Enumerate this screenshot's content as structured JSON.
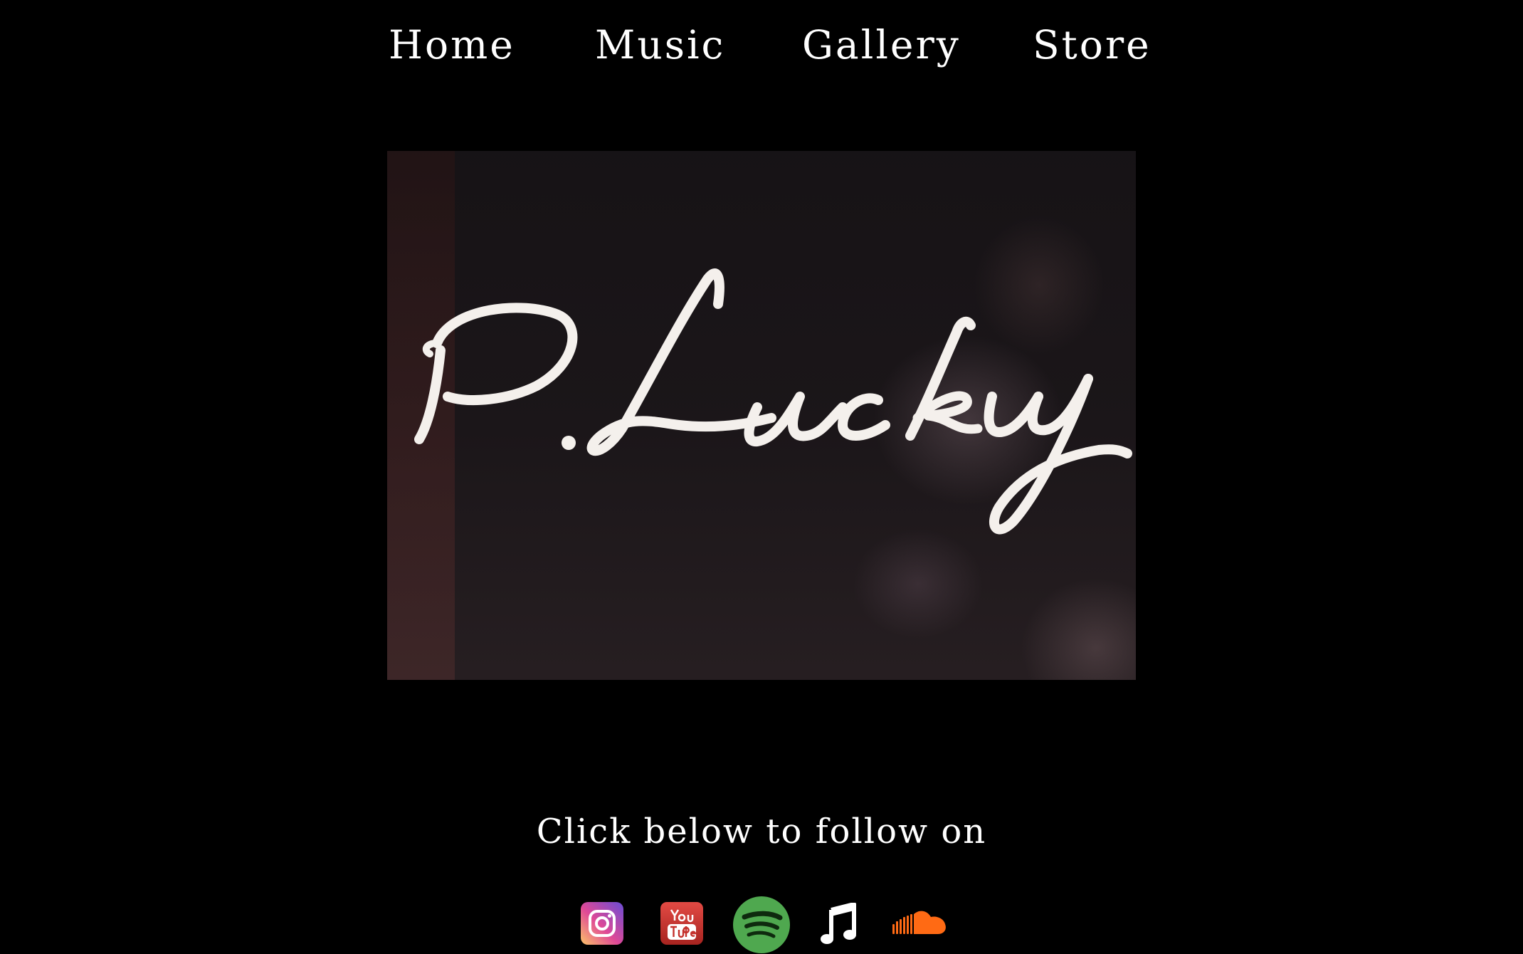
{
  "nav": {
    "items": [
      {
        "label": "Home"
      },
      {
        "label": "Music"
      },
      {
        "label": "Gallery"
      },
      {
        "label": "Store"
      }
    ]
  },
  "hero": {
    "logo_text": "P.Lucky"
  },
  "follow": {
    "text": "Click below to follow on"
  },
  "social": [
    {
      "name": "instagram-icon",
      "color": "#e1306c"
    },
    {
      "name": "youtube-icon",
      "color": "#c4302b"
    },
    {
      "name": "spotify-icon",
      "color": "#1db954"
    },
    {
      "name": "apple-music-icon",
      "color": "#ffffff"
    },
    {
      "name": "soundcloud-icon",
      "color": "#ff5500"
    }
  ]
}
